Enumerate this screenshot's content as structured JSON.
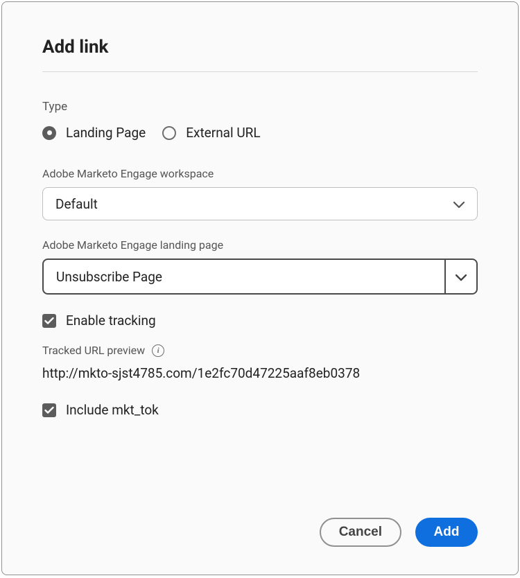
{
  "dialog": {
    "title": "Add link"
  },
  "type": {
    "label": "Type",
    "options": {
      "landing": "Landing Page",
      "external": "External URL"
    },
    "selected": "landing"
  },
  "workspace": {
    "label": "Adobe Marketo Engage workspace",
    "value": "Default"
  },
  "landingPage": {
    "label": "Adobe Marketo Engage landing page",
    "value": "Unsubscribe Page"
  },
  "tracking": {
    "enableLabel": "Enable tracking",
    "enabled": true,
    "previewLabel": "Tracked URL preview",
    "url": "http://mkto-sjst4785.com/1e2fc70d47225aaf8eb0378",
    "includeLabel": "Include mkt_tok",
    "includeEnabled": true
  },
  "buttons": {
    "cancel": "Cancel",
    "add": "Add"
  }
}
